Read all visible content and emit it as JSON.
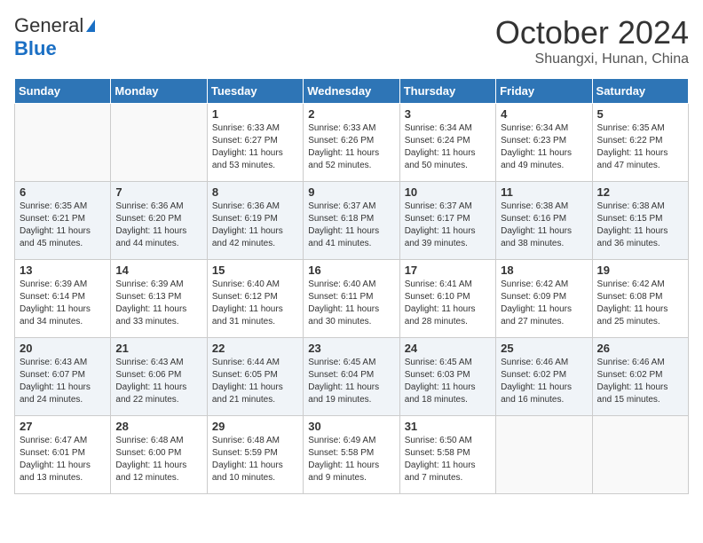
{
  "header": {
    "logo_general": "General",
    "logo_blue": "Blue",
    "month": "October 2024",
    "location": "Shuangxi, Hunan, China"
  },
  "days_of_week": [
    "Sunday",
    "Monday",
    "Tuesday",
    "Wednesday",
    "Thursday",
    "Friday",
    "Saturday"
  ],
  "weeks": [
    [
      {
        "day": "",
        "sunrise": "",
        "sunset": "",
        "daylight": ""
      },
      {
        "day": "",
        "sunrise": "",
        "sunset": "",
        "daylight": ""
      },
      {
        "day": "1",
        "sunrise": "Sunrise: 6:33 AM",
        "sunset": "Sunset: 6:27 PM",
        "daylight": "Daylight: 11 hours and 53 minutes."
      },
      {
        "day": "2",
        "sunrise": "Sunrise: 6:33 AM",
        "sunset": "Sunset: 6:26 PM",
        "daylight": "Daylight: 11 hours and 52 minutes."
      },
      {
        "day": "3",
        "sunrise": "Sunrise: 6:34 AM",
        "sunset": "Sunset: 6:24 PM",
        "daylight": "Daylight: 11 hours and 50 minutes."
      },
      {
        "day": "4",
        "sunrise": "Sunrise: 6:34 AM",
        "sunset": "Sunset: 6:23 PM",
        "daylight": "Daylight: 11 hours and 49 minutes."
      },
      {
        "day": "5",
        "sunrise": "Sunrise: 6:35 AM",
        "sunset": "Sunset: 6:22 PM",
        "daylight": "Daylight: 11 hours and 47 minutes."
      }
    ],
    [
      {
        "day": "6",
        "sunrise": "Sunrise: 6:35 AM",
        "sunset": "Sunset: 6:21 PM",
        "daylight": "Daylight: 11 hours and 45 minutes."
      },
      {
        "day": "7",
        "sunrise": "Sunrise: 6:36 AM",
        "sunset": "Sunset: 6:20 PM",
        "daylight": "Daylight: 11 hours and 44 minutes."
      },
      {
        "day": "8",
        "sunrise": "Sunrise: 6:36 AM",
        "sunset": "Sunset: 6:19 PM",
        "daylight": "Daylight: 11 hours and 42 minutes."
      },
      {
        "day": "9",
        "sunrise": "Sunrise: 6:37 AM",
        "sunset": "Sunset: 6:18 PM",
        "daylight": "Daylight: 11 hours and 41 minutes."
      },
      {
        "day": "10",
        "sunrise": "Sunrise: 6:37 AM",
        "sunset": "Sunset: 6:17 PM",
        "daylight": "Daylight: 11 hours and 39 minutes."
      },
      {
        "day": "11",
        "sunrise": "Sunrise: 6:38 AM",
        "sunset": "Sunset: 6:16 PM",
        "daylight": "Daylight: 11 hours and 38 minutes."
      },
      {
        "day": "12",
        "sunrise": "Sunrise: 6:38 AM",
        "sunset": "Sunset: 6:15 PM",
        "daylight": "Daylight: 11 hours and 36 minutes."
      }
    ],
    [
      {
        "day": "13",
        "sunrise": "Sunrise: 6:39 AM",
        "sunset": "Sunset: 6:14 PM",
        "daylight": "Daylight: 11 hours and 34 minutes."
      },
      {
        "day": "14",
        "sunrise": "Sunrise: 6:39 AM",
        "sunset": "Sunset: 6:13 PM",
        "daylight": "Daylight: 11 hours and 33 minutes."
      },
      {
        "day": "15",
        "sunrise": "Sunrise: 6:40 AM",
        "sunset": "Sunset: 6:12 PM",
        "daylight": "Daylight: 11 hours and 31 minutes."
      },
      {
        "day": "16",
        "sunrise": "Sunrise: 6:40 AM",
        "sunset": "Sunset: 6:11 PM",
        "daylight": "Daylight: 11 hours and 30 minutes."
      },
      {
        "day": "17",
        "sunrise": "Sunrise: 6:41 AM",
        "sunset": "Sunset: 6:10 PM",
        "daylight": "Daylight: 11 hours and 28 minutes."
      },
      {
        "day": "18",
        "sunrise": "Sunrise: 6:42 AM",
        "sunset": "Sunset: 6:09 PM",
        "daylight": "Daylight: 11 hours and 27 minutes."
      },
      {
        "day": "19",
        "sunrise": "Sunrise: 6:42 AM",
        "sunset": "Sunset: 6:08 PM",
        "daylight": "Daylight: 11 hours and 25 minutes."
      }
    ],
    [
      {
        "day": "20",
        "sunrise": "Sunrise: 6:43 AM",
        "sunset": "Sunset: 6:07 PM",
        "daylight": "Daylight: 11 hours and 24 minutes."
      },
      {
        "day": "21",
        "sunrise": "Sunrise: 6:43 AM",
        "sunset": "Sunset: 6:06 PM",
        "daylight": "Daylight: 11 hours and 22 minutes."
      },
      {
        "day": "22",
        "sunrise": "Sunrise: 6:44 AM",
        "sunset": "Sunset: 6:05 PM",
        "daylight": "Daylight: 11 hours and 21 minutes."
      },
      {
        "day": "23",
        "sunrise": "Sunrise: 6:45 AM",
        "sunset": "Sunset: 6:04 PM",
        "daylight": "Daylight: 11 hours and 19 minutes."
      },
      {
        "day": "24",
        "sunrise": "Sunrise: 6:45 AM",
        "sunset": "Sunset: 6:03 PM",
        "daylight": "Daylight: 11 hours and 18 minutes."
      },
      {
        "day": "25",
        "sunrise": "Sunrise: 6:46 AM",
        "sunset": "Sunset: 6:02 PM",
        "daylight": "Daylight: 11 hours and 16 minutes."
      },
      {
        "day": "26",
        "sunrise": "Sunrise: 6:46 AM",
        "sunset": "Sunset: 6:02 PM",
        "daylight": "Daylight: 11 hours and 15 minutes."
      }
    ],
    [
      {
        "day": "27",
        "sunrise": "Sunrise: 6:47 AM",
        "sunset": "Sunset: 6:01 PM",
        "daylight": "Daylight: 11 hours and 13 minutes."
      },
      {
        "day": "28",
        "sunrise": "Sunrise: 6:48 AM",
        "sunset": "Sunset: 6:00 PM",
        "daylight": "Daylight: 11 hours and 12 minutes."
      },
      {
        "day": "29",
        "sunrise": "Sunrise: 6:48 AM",
        "sunset": "Sunset: 5:59 PM",
        "daylight": "Daylight: 11 hours and 10 minutes."
      },
      {
        "day": "30",
        "sunrise": "Sunrise: 6:49 AM",
        "sunset": "Sunset: 5:58 PM",
        "daylight": "Daylight: 11 hours and 9 minutes."
      },
      {
        "day": "31",
        "sunrise": "Sunrise: 6:50 AM",
        "sunset": "Sunset: 5:58 PM",
        "daylight": "Daylight: 11 hours and 7 minutes."
      },
      {
        "day": "",
        "sunrise": "",
        "sunset": "",
        "daylight": ""
      },
      {
        "day": "",
        "sunrise": "",
        "sunset": "",
        "daylight": ""
      }
    ]
  ]
}
